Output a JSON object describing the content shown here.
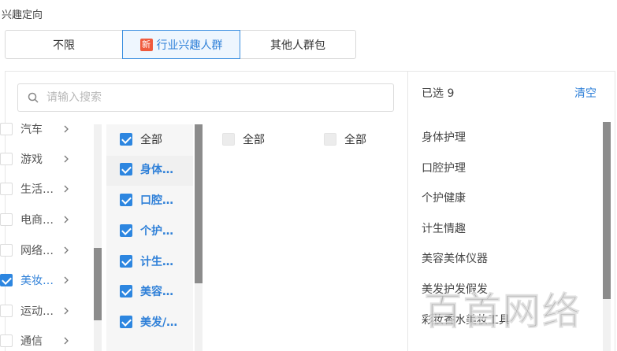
{
  "section_title": "兴趣定向",
  "tabs": [
    {
      "label": "不限"
    },
    {
      "label": "行业兴趣人群",
      "badge": "新"
    },
    {
      "label": "其他人群包"
    }
  ],
  "search": {
    "placeholder": "请输入搜索"
  },
  "category_list": [
    {
      "label": "汽车",
      "checked": false
    },
    {
      "label": "游戏",
      "checked": false
    },
    {
      "label": "生活…",
      "checked": false
    },
    {
      "label": "电商…",
      "checked": false
    },
    {
      "label": "网络…",
      "checked": false
    },
    {
      "label": "美妆…",
      "checked": true
    },
    {
      "label": "运动…",
      "checked": false
    },
    {
      "label": "通信",
      "checked": false
    }
  ],
  "sub_list": [
    {
      "label": "全部",
      "checked": true
    },
    {
      "label": "身体…",
      "checked": true
    },
    {
      "label": "口腔…",
      "checked": true
    },
    {
      "label": "个护…",
      "checked": true
    },
    {
      "label": "计生…",
      "checked": true
    },
    {
      "label": "美容…",
      "checked": true
    },
    {
      "label": "美发/…",
      "checked": true
    }
  ],
  "col3_all": "全部",
  "col4_all": "全部",
  "selected": {
    "count_text": "已选 9",
    "clear_label": "清空",
    "items": [
      "身体护理",
      "口腔护理",
      "个护健康",
      "计生情趣",
      "美容美体仪器",
      "美发护发假发",
      "彩妆香水美妆工具"
    ]
  },
  "watermark": "百首网络",
  "colors": {
    "accent": "#2f80d8",
    "badge": "#f05a3d"
  }
}
